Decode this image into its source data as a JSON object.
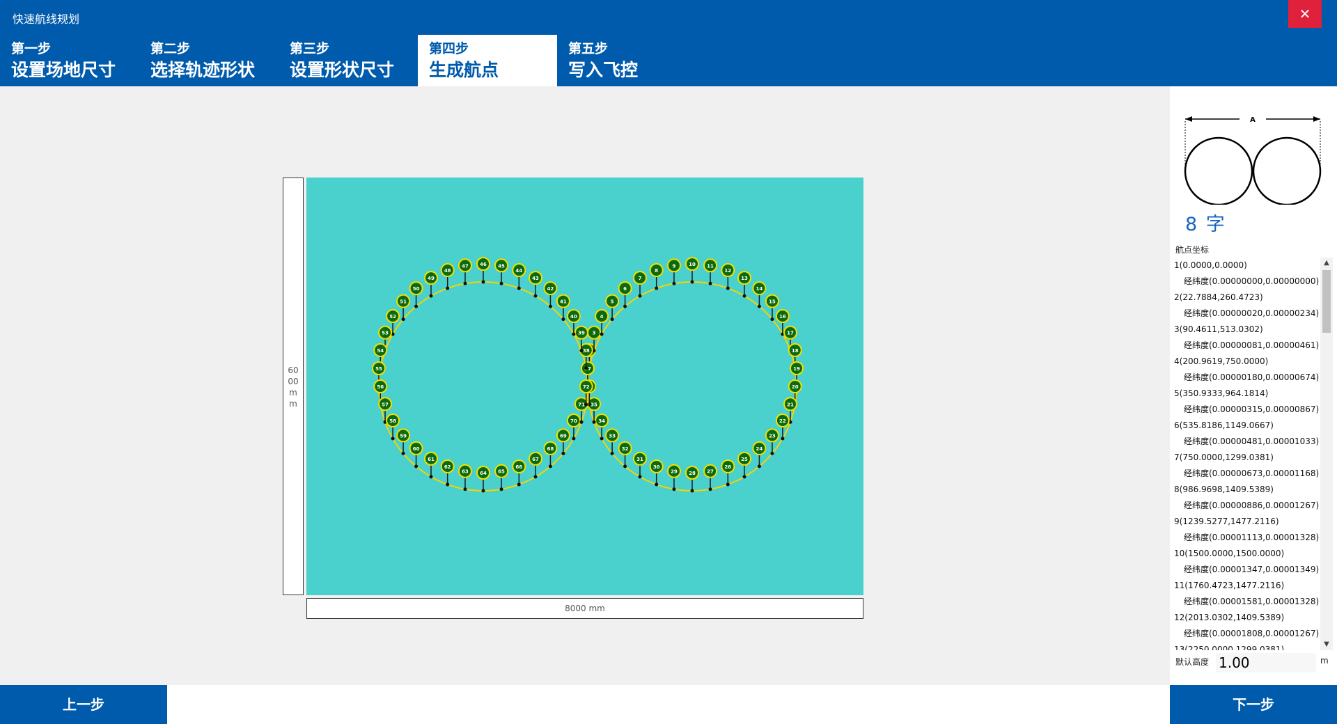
{
  "app": {
    "title": "快速航线规划",
    "close_label": "✕"
  },
  "steps": [
    {
      "no": "第一步",
      "name": "设置场地尺寸",
      "active": false
    },
    {
      "no": "第二步",
      "name": "选择轨迹形状",
      "active": false
    },
    {
      "no": "第三步",
      "name": "设置形状尺寸",
      "active": false
    },
    {
      "no": "第四步",
      "name": "生成航点",
      "active": true
    },
    {
      "no": "第五步",
      "name": "写入飞控",
      "active": false
    }
  ],
  "field": {
    "width_label": "8000 mm",
    "height_label": "6000mm",
    "color": "#4ad0cd",
    "path_color": "#f2d600",
    "marker_fill": "#0c6a0c",
    "marker_ring": "#f2e000",
    "waypoint_count": 72
  },
  "shape": {
    "name": "8 字",
    "dimension_label": "A"
  },
  "coords": {
    "title": "航点坐标",
    "lines": [
      "1(0.0000,0.0000)",
      "经纬度(0.00000000,0.00000000)",
      "2(22.7884,260.4723)",
      "经纬度(0.00000020,0.00000234)",
      "3(90.4611,513.0302)",
      "经纬度(0.00000081,0.00000461)",
      "4(200.9619,750.0000)",
      "经纬度(0.00000180,0.00000674)",
      "5(350.9333,964.1814)",
      "经纬度(0.00000315,0.00000867)",
      "6(535.8186,1149.0667)",
      "经纬度(0.00000481,0.00001033)",
      "7(750.0000,1299.0381)",
      "经纬度(0.00000673,0.00001168)",
      "8(986.9698,1409.5389)",
      "经纬度(0.00000886,0.00001267)",
      "9(1239.5277,1477.2116)",
      "经纬度(0.00001113,0.00001328)",
      "10(1500.0000,1500.0000)",
      "经纬度(0.00001347,0.00001349)",
      "11(1760.4723,1477.2116)",
      "经纬度(0.00001581,0.00001328)",
      "12(2013.0302,1409.5389)",
      "经纬度(0.00001808,0.00001267)",
      "13(2250.0000,1299.0381)"
    ]
  },
  "default_height": {
    "label": "默认高度",
    "value": "1.00",
    "unit": "m"
  },
  "nav": {
    "prev_label": "上一步",
    "next_label": "下一步"
  }
}
